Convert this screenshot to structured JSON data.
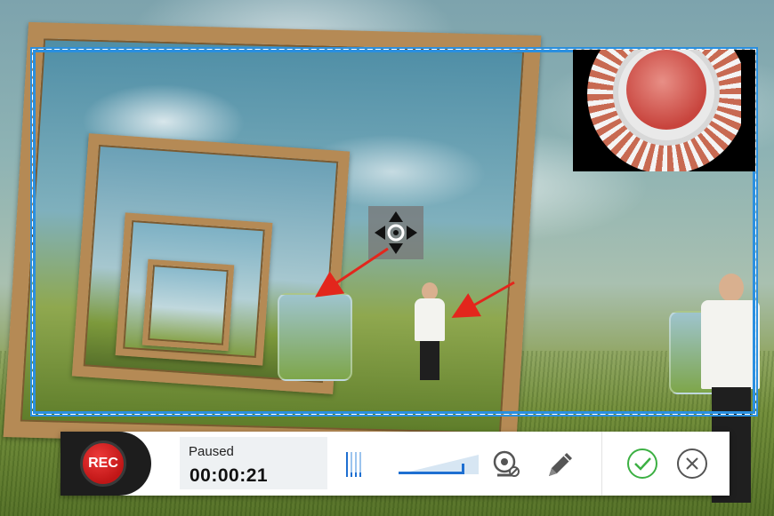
{
  "toolbar": {
    "rec_label": "REC",
    "status_label": "Paused",
    "timer": "00:00:21",
    "volume_level": 0.82
  },
  "icons": {
    "move_handle": "four-way-move-icon",
    "volume": "audio-level-icon",
    "webcam": "webcam-icon",
    "pen": "pen-icon",
    "confirm": "check-circle-icon",
    "close": "close-circle-icon"
  },
  "colors": {
    "capture_border": "#2a8fe0",
    "rec_button": "#d21f1f",
    "confirm": "#3cb043",
    "accent": "#1e6fd1",
    "annotation_arrows": "#e3261c"
  }
}
